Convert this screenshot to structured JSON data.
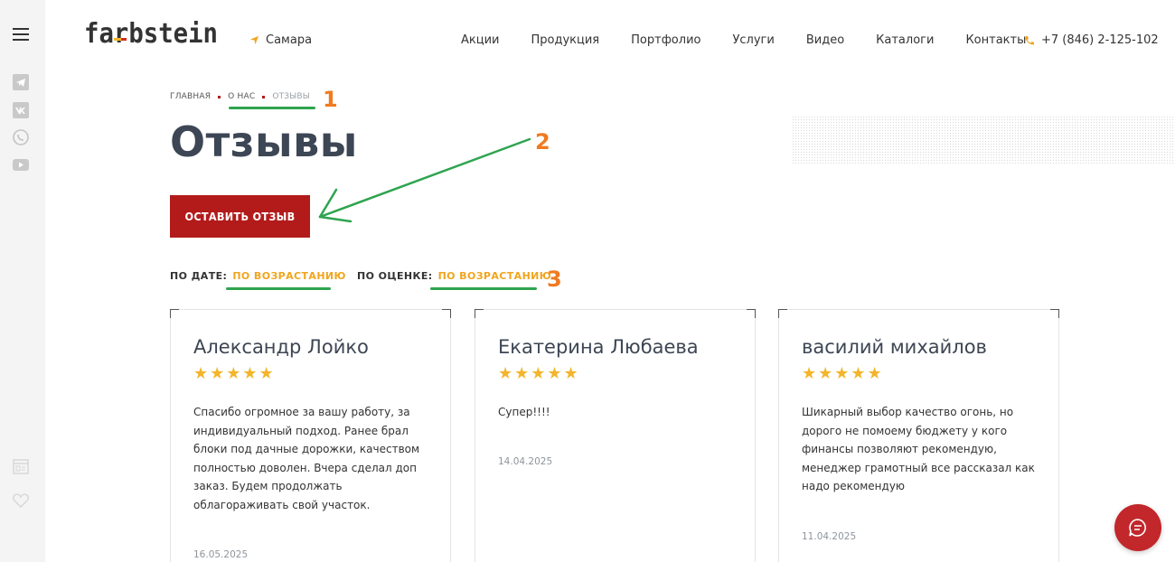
{
  "header": {
    "logo_text": "farbstein",
    "city": "Самара",
    "nav": [
      "Акции",
      "Продукция",
      "Портфолио",
      "Услуги",
      "Видео",
      "Каталоги",
      "Контакты"
    ],
    "phone": "+7 (846) 2-125-102"
  },
  "sidebar": {
    "social": [
      "telegram-icon",
      "vk-icon",
      "whatsapp-icon",
      "youtube-icon"
    ],
    "bottom": [
      "compare-icon",
      "heart-icon"
    ]
  },
  "breadcrumbs": [
    "ГЛАВНАЯ",
    "О НАС",
    "ОТЗЫВЫ"
  ],
  "page": {
    "title": "Отзывы",
    "button": "ОСТАВИТЬ ОТЗЫВ"
  },
  "sort": {
    "date_label": "ПО ДАТЕ:",
    "date_value": "ПО ВОЗРАСТАНИЮ",
    "rating_label": "ПО ОЦЕНКЕ:",
    "rating_value": "ПО ВОЗРАСТАНИЮ"
  },
  "annotations": [
    "1",
    "2",
    "3"
  ],
  "reviews": [
    {
      "name": "Александр Лойко",
      "stars": "★★★★★",
      "text": "Спасибо огромное за вашу работу, за индивидуальный подход. Ранее брал блоки под дачные дорожки, качеством полностью доволен. Вчера сделал доп заказ. Будем продолжать облагораживать свой участок.",
      "date": "16.05.2025"
    },
    {
      "name": "Екатерина Любаева",
      "stars": "★★★★★",
      "text": "Супер!!!!",
      "date": "14.04.2025"
    },
    {
      "name": "василий михайлов",
      "stars": "★★★★★",
      "text": "Шикарный выбор качество огонь, но дорого не помоему бюджету у кого финансы позволяют рекомендую, менеджер грамотный все рассказал как надо рекомендую",
      "date": "11.04.2025"
    }
  ],
  "colors": {
    "brand_red": "#b31b1b",
    "accent_orange": "#f07a20",
    "sort_yellow": "#f0a51e",
    "star_yellow": "#f4b52b",
    "annotation_green": "#2fa44f"
  }
}
